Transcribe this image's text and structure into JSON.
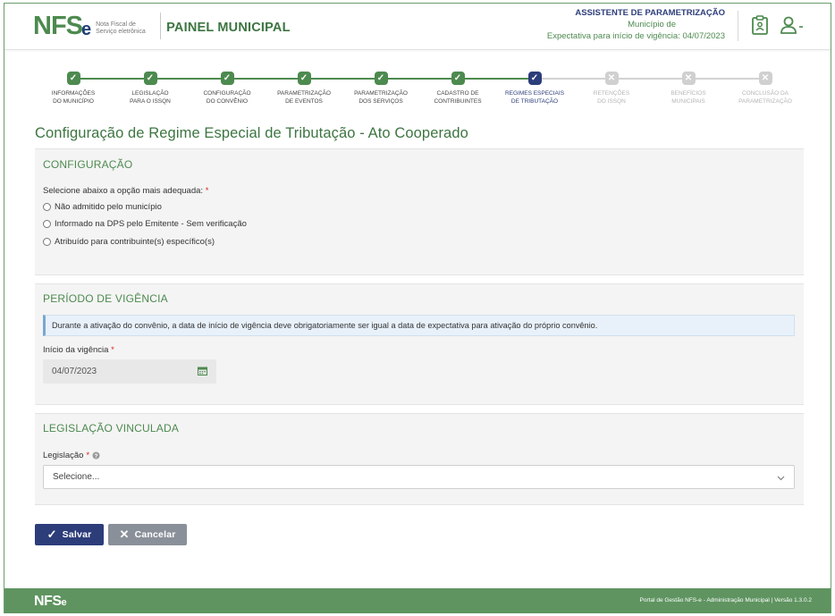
{
  "header": {
    "logo_text": "NFS",
    "logo_suffix": "e",
    "logo_subtitle": "Nota Fiscal de Serviço eletrônica",
    "panel_title": "PAINEL MUNICIPAL",
    "assistant_title": "ASSISTENTE DE PARAMETRIZAÇÃO",
    "municipality_label": "Município de",
    "expectation_text": "Expectativa para início de vigência: 04/07/2023",
    "icons": [
      "clipboard-badge-icon",
      "user-icon"
    ]
  },
  "stepper": {
    "steps": [
      {
        "line1": "INFORMAÇÕES",
        "line2": "DO MUNICÍPIO",
        "status": "done"
      },
      {
        "line1": "LEGISLAÇÃO",
        "line2": "PARA O ISSQN",
        "status": "done"
      },
      {
        "line1": "CONFIGURAÇÃO",
        "line2": "DO CONVÊNIO",
        "status": "done"
      },
      {
        "line1": "PARAMETRIZAÇÃO",
        "line2": "DE EVENTOS",
        "status": "done"
      },
      {
        "line1": "PARAMETRIZAÇÃO",
        "line2": "DOS SERVIÇOS",
        "status": "done"
      },
      {
        "line1": "CADASTRO DE",
        "line2": "CONTRIBUINTES",
        "status": "done"
      },
      {
        "line1": "REGIMES ESPECIAIS",
        "line2": "DE TRIBUTAÇÃO",
        "status": "current"
      },
      {
        "line1": "RETENÇÕES",
        "line2": "DO ISSQN",
        "status": "pending"
      },
      {
        "line1": "BENEFÍCIOS",
        "line2": "MUNICIPAIS",
        "status": "pending"
      },
      {
        "line1": "CONCLUSÃO DA",
        "line2": "PARAMETRIZAÇÃO",
        "status": "pending"
      }
    ]
  },
  "page_title": "Configuração de Regime Especial de Tributação - Ato Cooperado",
  "configuracao": {
    "title": "CONFIGURAÇÃO",
    "prompt": "Selecione abaixo a opção mais adequada:",
    "required_mark": "*",
    "options": [
      "Não admitido pelo município",
      "Informado na DPS pelo Emitente - Sem verificação",
      "Atribuído para contribuinte(s) específico(s)"
    ]
  },
  "vigencia": {
    "title": "PERÍODO DE VIGÊNCIA",
    "info": "Durante a ativação do convênio, a data de início de vigência deve obrigatoriamente ser igual a data de expectativa para ativação do próprio convênio.",
    "start_label": "Início da vigência",
    "required_mark": "*",
    "start_value": "04/07/2023"
  },
  "legislacao": {
    "title": "LEGISLAÇÃO VINCULADA",
    "field_label": "Legislação",
    "required_mark": "*",
    "select_value": "Selecione..."
  },
  "actions": {
    "save_label": "Salvar",
    "cancel_label": "Cancelar"
  },
  "footer": {
    "logo": "NFS",
    "logo_suffix": "e",
    "text": "Portal de Gestão NFS-e - Administração Municipal | Versão 1.3.0.2"
  },
  "colors": {
    "brand_green": "#4d8a4f",
    "brand_navy": "#2c3d7a",
    "footer_green": "#5f9460"
  }
}
